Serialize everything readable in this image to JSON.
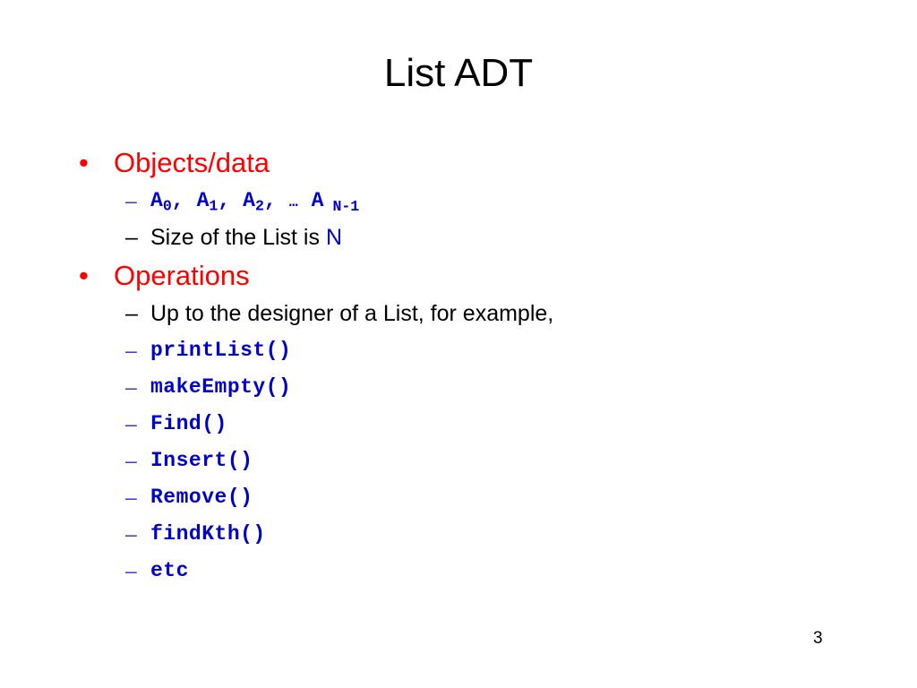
{
  "slide": {
    "title": "List ADT",
    "page_number": "3",
    "colors": {
      "heading": "#FF0000",
      "code": "#0000CC",
      "body": "#000000",
      "background": "#FFFFFF"
    },
    "bullet_glyph": "•",
    "dash_glyph": "–",
    "sections": [
      {
        "heading": "Objects/data",
        "items": [
          {
            "style": "code-sequence",
            "terms": [
              {
                "base": "A",
                "sub": "0",
                "sep": ","
              },
              {
                "base": "A",
                "sub": "1",
                "sep": ","
              },
              {
                "base": "A",
                "sub": "2",
                "sep": ","
              }
            ],
            "ellipsis": "…",
            "last_base": "A",
            "last_sub": "N-1",
            "plain": "A0, A1, A2, … A N-1"
          },
          {
            "style": "prose",
            "text_before": "Size of the List is ",
            "highlight": "N",
            "text_after": ""
          }
        ]
      },
      {
        "heading": "Operations",
        "items": [
          {
            "style": "prose",
            "text_before": "Up to the designer of a List, for example,",
            "highlight": "",
            "text_after": ""
          },
          {
            "style": "code",
            "text": "printList()"
          },
          {
            "style": "code",
            "text": "makeEmpty()"
          },
          {
            "style": "code",
            "text": "Find()"
          },
          {
            "style": "code",
            "text": "Insert()"
          },
          {
            "style": "code",
            "text": "Remove()"
          },
          {
            "style": "code",
            "text": "findKth()"
          },
          {
            "style": "code",
            "text": "etc"
          }
        ]
      }
    ]
  }
}
